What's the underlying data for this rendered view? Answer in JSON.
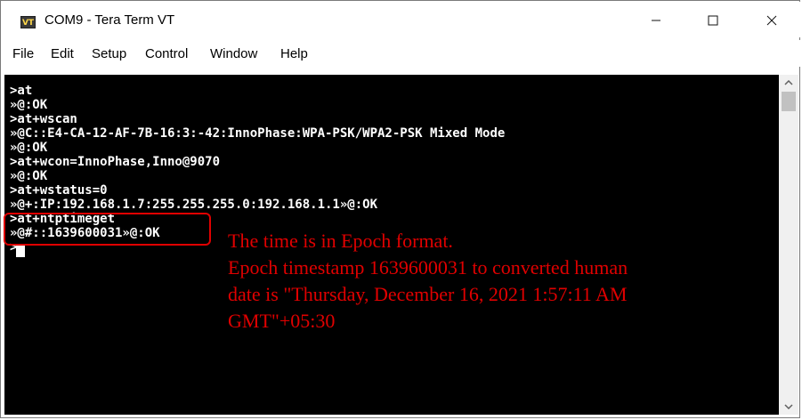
{
  "window": {
    "title": "COM9 - Tera Term VT",
    "icon_text": "VT",
    "icon_name": "tera-term-icon",
    "minimize_icon": "minimize-icon",
    "maximize_icon": "maximize-icon",
    "close_icon": "close-icon"
  },
  "menu": [
    "File",
    "Edit",
    "Setup",
    "Control",
    "Window",
    "Help"
  ],
  "terminal": {
    "lines": [
      ">at",
      "»@:OK",
      ">at+wscan",
      "»@C::E4-CA-12-AF-7B-16:3:-42:InnoPhase:WPA-PSK/WPA2-PSK Mixed Mode",
      "»@:OK",
      ">at+wcon=InnoPhase,Inno@9070",
      "»@:OK",
      ">at+wstatus=0",
      "»@+:IP:192.168.1.7:255.255.255.0:192.168.1.1»@:OK",
      ">at+ntptimeget",
      "»@#::1639600031»@:OK",
      ">"
    ]
  },
  "annotation": {
    "lines": [
      "The time is in Epoch format.",
      "Epoch timestamp 1639600031 to converted human",
      "date is \"Thursday, December 16, 2021 1:57:11 AM",
      "GMT\"+05:30"
    ],
    "color": "#e00000"
  },
  "colors": {
    "terminal_bg": "#000000",
    "terminal_fg": "#ffffff",
    "highlight": "#e00000"
  }
}
